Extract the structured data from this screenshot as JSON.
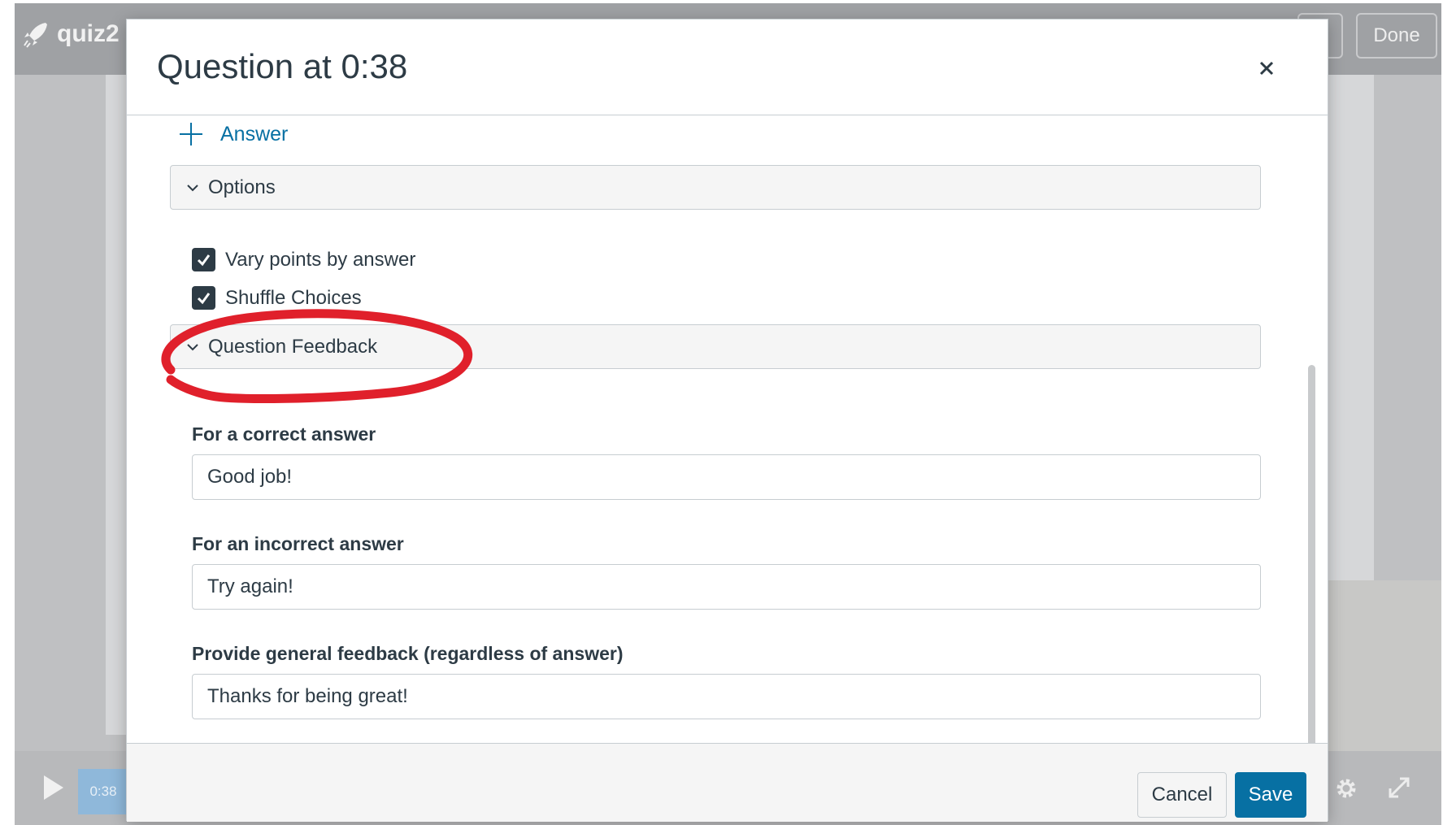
{
  "background": {
    "app_name": "quiz2",
    "done_label": "Done",
    "playback_time": "0:38"
  },
  "modal": {
    "title": "Question at 0:38",
    "add_answer_label": "Answer",
    "options": {
      "header": "Options",
      "vary_points": {
        "label": "Vary points by answer",
        "checked": true
      },
      "shuffle_choices": {
        "label": "Shuffle Choices",
        "checked": true
      }
    },
    "question_feedback": {
      "header": "Question Feedback",
      "correct": {
        "label": "For a correct answer",
        "value": "Good job!"
      },
      "incorrect": {
        "label": "For an incorrect answer",
        "value": "Try again!"
      },
      "general": {
        "label": "Provide general feedback (regardless of answer)",
        "value": "Thanks for being great!"
      }
    },
    "footer": {
      "cancel_label": "Cancel",
      "save_label": "Save"
    }
  },
  "colors": {
    "primary": "#0770a3",
    "text": "#2d3b45",
    "border": "#c7cdd1",
    "annotation": "#e0202b"
  },
  "icons": [
    "rocket-icon",
    "close-icon",
    "plus-icon",
    "chevron-down-icon",
    "checkmark-icon",
    "play-icon",
    "gear-icon",
    "expand-icon"
  ]
}
